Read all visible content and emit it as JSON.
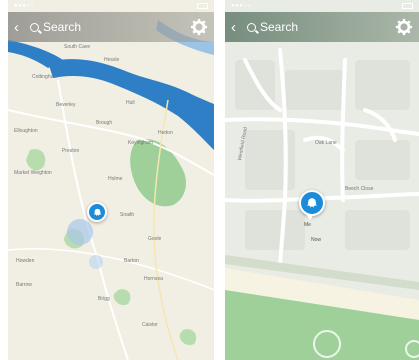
{
  "left_screen": {
    "search_placeholder": "Search",
    "place_labels": [
      "South Cave",
      "Hessle",
      "Cottingham",
      "Beverley",
      "Hull",
      "Brough",
      "Elloughton",
      "Hedon",
      "Preston",
      "Keyingham",
      "Market Weighton",
      "Holme",
      "Snaith",
      "Goole",
      "Howden",
      "Barton",
      "Barrow",
      "Hornsea",
      "Brigg",
      "Caistor"
    ],
    "pin_icon": "ghost-icon",
    "gear_icon": "gear-icon"
  },
  "right_screen": {
    "search_placeholder": "Search",
    "street_labels": [
      "Westfield Road",
      "Beech Close",
      "Oak Lane"
    ],
    "pin_icon": "ghost-icon",
    "gear_icon": "gear-icon",
    "pin_caption": [
      "Me",
      "Now"
    ]
  },
  "colors": {
    "water": "#2f7fc6",
    "snap_blue": "#1c8cd8",
    "green_patch": "#9fd09a",
    "road": "#ffffff"
  }
}
